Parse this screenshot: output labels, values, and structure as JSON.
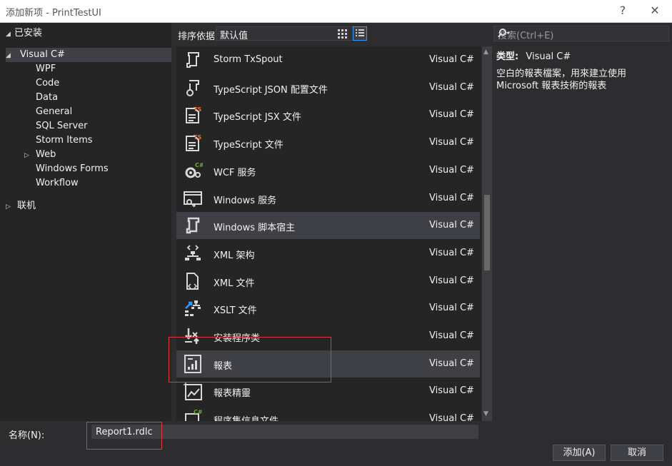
{
  "window": {
    "title": "添加新项 - PrintTestUI",
    "help_label": "?",
    "close_label": "✕"
  },
  "tree": {
    "installed_label": "已安装",
    "root_label": "Visual C#",
    "children": [
      "WPF",
      "Code",
      "Data",
      "General",
      "SQL Server",
      "Storm Items",
      "Web",
      "Windows Forms",
      "Workflow"
    ],
    "online_label": "联机"
  },
  "toolbar": {
    "sort_label": "排序依据:",
    "sort_value": "默认值"
  },
  "search": {
    "placeholder": "搜索(Ctrl+E)"
  },
  "items": [
    {
      "name": "Storm TxSpout",
      "lang": "Visual C#",
      "icon": "storm-icon"
    },
    {
      "name": "TypeScript JSON 配置文件",
      "lang": "Visual C#",
      "icon": "typescript-json-icon"
    },
    {
      "name": "TypeScript JSX 文件",
      "lang": "Visual C#",
      "icon": "typescript-file-icon"
    },
    {
      "name": "TypeScript 文件",
      "lang": "Visual C#",
      "icon": "typescript-file-icon"
    },
    {
      "name": "WCF 服务",
      "lang": "Visual C#",
      "icon": "wcf-service-icon"
    },
    {
      "name": "Windows 服务",
      "lang": "Visual C#",
      "icon": "windows-service-icon"
    },
    {
      "name": "Windows 脚本宿主",
      "lang": "Visual C#",
      "icon": "script-host-icon"
    },
    {
      "name": "XML 架构",
      "lang": "Visual C#",
      "icon": "xml-schema-icon"
    },
    {
      "name": "XML 文件",
      "lang": "Visual C#",
      "icon": "xml-file-icon"
    },
    {
      "name": "XSLT 文件",
      "lang": "Visual C#",
      "icon": "xslt-file-icon"
    },
    {
      "name": "安装程序类",
      "lang": "Visual C#",
      "icon": "installer-class-icon"
    },
    {
      "name": "報表",
      "lang": "Visual C#",
      "icon": "report-icon"
    },
    {
      "name": "報表精靈",
      "lang": "Visual C#",
      "icon": "report-wizard-icon"
    },
    {
      "name": "程序集信息文件",
      "lang": "Visual C#",
      "icon": "assembly-info-icon"
    }
  ],
  "detail": {
    "type_label": "类型:",
    "type_value": "Visual C#",
    "description": "空白的報表檔案，用來建立使用 Microsoft 報表技術的報表"
  },
  "bottom": {
    "name_label": "名称(N):",
    "name_value": "Report1.rdlc",
    "add_label": "添加(A)",
    "cancel_label": "取消"
  },
  "colors": {
    "background": "#2d2d30",
    "panel": "#252526",
    "selection": "#3f3f46",
    "accent": "#3399ff",
    "highlight_box": "#e0393e"
  }
}
